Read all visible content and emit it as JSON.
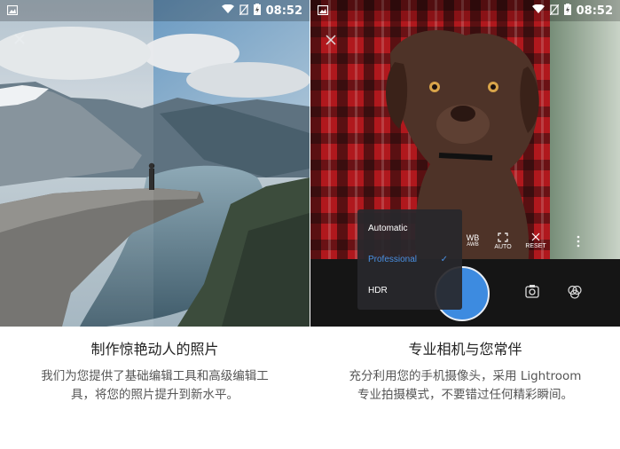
{
  "status_bar": {
    "time": "08:52"
  },
  "left_panel": {
    "title": "制作惊艳动人的照片",
    "description": "我们为您提供了基础编辑工具和高级编辑工具，将您的照片提升到新水平。"
  },
  "right_panel": {
    "title": "专业相机与您常伴",
    "description": "充分利用您的手机摄像头，采用 Lightroom 专业拍摄模式，不要错过任何精彩瞬间。",
    "camera_mode_menu": {
      "items": [
        {
          "label": "Automatic",
          "selected": false
        },
        {
          "label": "Professional",
          "selected": true
        },
        {
          "label": "HDR",
          "selected": false
        }
      ]
    },
    "camera_controls": {
      "wb_label": "WB",
      "wb_sub": "AWB",
      "auto_label": "AUTO",
      "reset_label": "RESET"
    }
  },
  "colors": {
    "accent": "#4a90e2",
    "shutter": "#3d8be0"
  }
}
